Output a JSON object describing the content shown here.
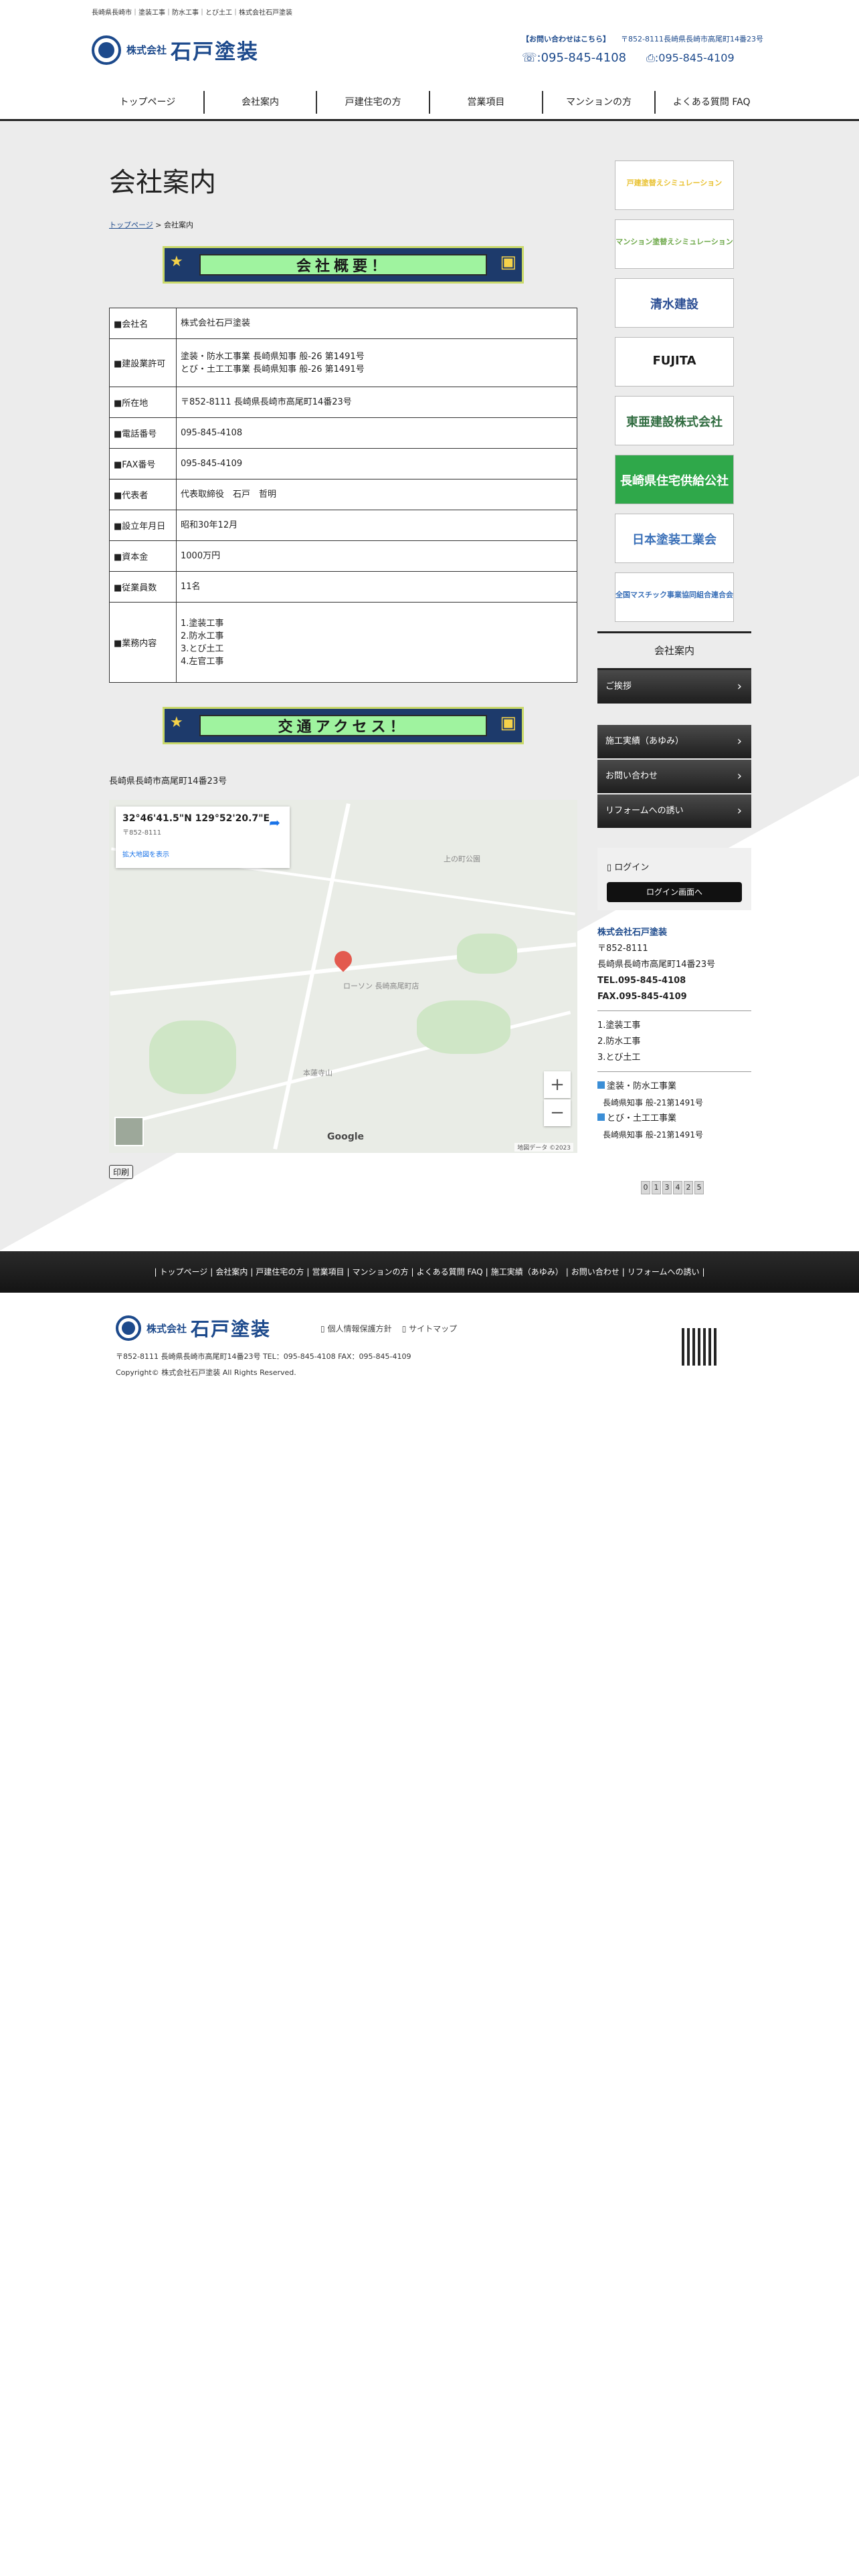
{
  "header": {
    "topline": "長崎県長崎市｜塗装工事｜防水工事｜とび土工｜株式会社石戸塗装",
    "logo_small": "株式会社",
    "logo_big": "石戸塗装",
    "contact_label": "【お問い合わせはこちら】",
    "address": "〒852-8111長崎県長崎市高尾町14番23号",
    "tel": ":095-845-4108",
    "fax": ":095-845-4109"
  },
  "nav": [
    "トップページ",
    "会社案内",
    "戸建住宅の方",
    "営業項目",
    "マンションの方",
    "よくある質問 FAQ"
  ],
  "main": {
    "title": "会社案内",
    "crumb_home": "トップページ",
    "crumb_sep": " > ",
    "crumb_current": "会社案内",
    "banner1": "会社概要！",
    "banner2": "交通アクセス！",
    "address_line": "長崎県長崎市高尾町14番23号",
    "print": "印刷"
  },
  "company_table": [
    {
      "key": "■会社名",
      "value": [
        "株式会社石戸塗装"
      ]
    },
    {
      "key": "■建設業許可",
      "value": [
        "塗装・防水工事業 長崎県知事 般-26 第1491号",
        "とび・土工工事業 長崎県知事 般-26 第1491号"
      ]
    },
    {
      "key": "■所在地",
      "value": [
        "〒852-8111 長崎県長崎市高尾町14番23号"
      ]
    },
    {
      "key": "■電話番号",
      "value": [
        "095-845-4108"
      ]
    },
    {
      "key": "■FAX番号",
      "value": [
        "095-845-4109"
      ]
    },
    {
      "key": "■代表者",
      "value": [
        "代表取締役　石戸　哲明"
      ]
    },
    {
      "key": "■設立年月日",
      "value": [
        "昭和30年12月"
      ]
    },
    {
      "key": "■資本金",
      "value": [
        "1000万円"
      ]
    },
    {
      "key": "■従業員数",
      "value": [
        "11名"
      ]
    },
    {
      "key": "■業務内容",
      "value": [
        "1.塗装工事",
        "2.防水工事",
        "3.とび土工",
        "4.左官工事"
      ]
    }
  ],
  "map": {
    "coord": "32°46'41.5\"N 129°52'20.7\"E",
    "sub": "〒852-8111",
    "link": "拡大地図を表示",
    "google": "Google",
    "copyright": "地図データ ©2023",
    "place1": "ローソン 長崎高尾町店",
    "place2": "本蓮寺山",
    "place3": "上の町公園",
    "zoom_in": "+",
    "zoom_out": "−"
  },
  "sidebar": {
    "banners": [
      {
        "text": "戸建塗替えシミュレーション",
        "color": "#e9c233"
      },
      {
        "text": "マンション塗替えシミュレーション",
        "color": "#6fa94b"
      },
      {
        "text": "清水建設",
        "color": "#2a4d93"
      },
      {
        "text": "FUJITA",
        "color": "#1a1a1a"
      },
      {
        "text": "東亜建設株式会社",
        "color": "#2f6b3f"
      },
      {
        "text": "長崎県住宅供給公社",
        "color": "#2fa84a"
      },
      {
        "text": "日本塗装工業会",
        "color": "#3a70b8"
      },
      {
        "text": "全国マスチック事業協同組合連合会",
        "color": "#3a70b8"
      }
    ],
    "section_title": "会社案内",
    "menu1": [
      "ご挨拶"
    ],
    "menu2": [
      "施工実績（あゆみ）",
      "お問い合わせ",
      "リフォームへの誘い"
    ],
    "login_title": "ログイン",
    "login_button": "ログイン画面へ",
    "company": {
      "name": "株式会社石戸塗装",
      "zip": "〒852-8111",
      "addr": "長崎県長崎市高尾町14番23号",
      "tel": "TEL.095-845-4108",
      "fax": "FAX.095-845-4109",
      "services": [
        "1.塗装工事",
        "2.防水工事",
        "3.とび土工"
      ],
      "license1_title": "塗装・防水工事業",
      "license1": "長崎県知事 般-21第1491号",
      "license2_title": "とび・土工工事業",
      "license2": "長崎県知事 般-21第1491号"
    }
  },
  "counter": [
    "0",
    "1",
    "3",
    "4",
    "2",
    "5"
  ],
  "footer_nav": [
    "トップページ",
    "会社案内",
    "戸建住宅の方",
    "営業項目",
    "マンションの方",
    "よくある質問 FAQ",
    "施工実績（あゆみ）",
    "お問い合わせ",
    "リフォームへの誘い"
  ],
  "footer": {
    "logo_small": "株式会社",
    "logo_big": "石戸塗装",
    "privacy": "個人情報保護方針",
    "sitemap": "サイトマップ",
    "address": "〒852-8111 長崎県長崎市高尾町14番23号 TEL：095-845-4108  FAX：095-845-4109",
    "copyright": "Copyright© 株式会社石戸塗装 All Rights Reserved."
  },
  "colors": {
    "brand": "#1d4a8c",
    "accent_link": "#1a73e8"
  }
}
